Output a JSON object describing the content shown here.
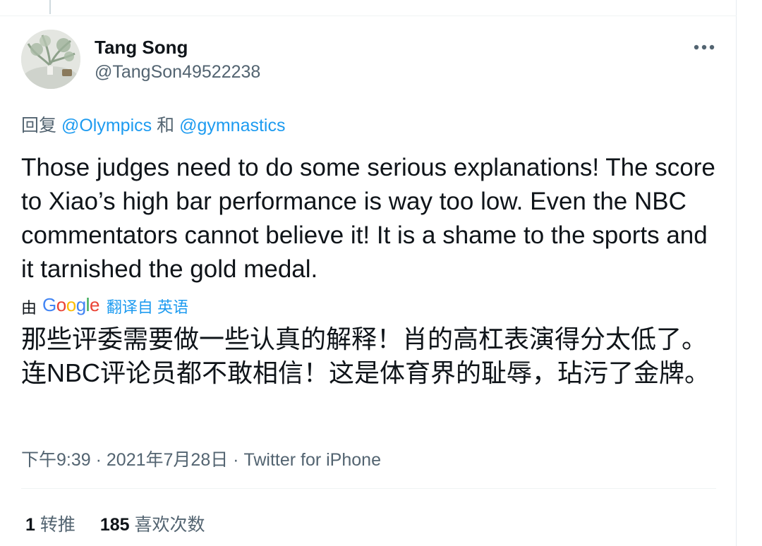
{
  "user": {
    "name": "Tang Song",
    "handle": "@TangSon49522238"
  },
  "reply": {
    "prefix": "回复",
    "to_1": "@Olympics",
    "conjunction": "和",
    "to_2": "@gymnastics"
  },
  "tweet": {
    "text": "Those judges need to do some serious explanations! The score to Xiao’s high bar performance is way too low. Even the NBC commentators cannot believe it! It is a shame to the sports and it tarnished the gold medal."
  },
  "translation": {
    "by_label": "由",
    "provider": "Google",
    "link_label": "翻译自 英语",
    "text": "那些评委需要做一些认真的解释！肖的高杠表演得分太低了。连NBC评论员都不敢相信！这是体育界的耻辱，玷污了金牌。"
  },
  "meta": {
    "time": "下午9:39",
    "separator": " · ",
    "date": "2021年7月28日",
    "source": "Twitter for iPhone"
  },
  "stats": {
    "retweets_count": "1",
    "retweets_label": "转推",
    "likes_count": "185",
    "likes_label": "喜欢次数"
  },
  "colors": {
    "link": "#1d9bf0",
    "secondary_text": "#536471",
    "primary_text": "#0f1419",
    "google_blue": "#4285F4",
    "google_red": "#EA4335",
    "google_yellow": "#FBBC05",
    "google_green": "#34A853"
  },
  "icons": {
    "more": "more-horizontal-icon",
    "avatar": "avatar"
  }
}
